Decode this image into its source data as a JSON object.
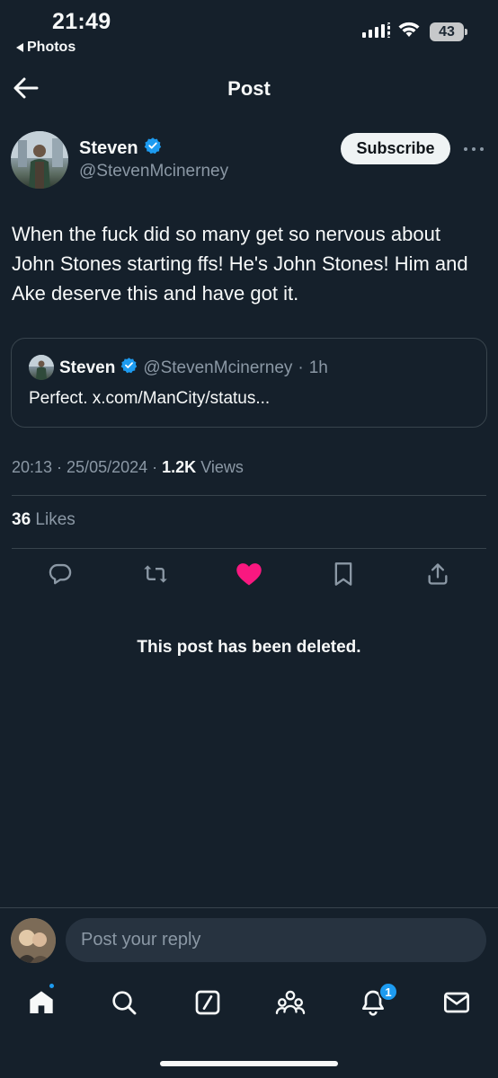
{
  "status_bar": {
    "time": "21:49",
    "back_app": "Photos",
    "battery": "43"
  },
  "header": {
    "title": "Post"
  },
  "post": {
    "author_name": "Steven",
    "author_handle": "@StevenMcinerney",
    "subscribe_label": "Subscribe",
    "text": "When the fuck did so many get so nervous about John Stones starting ffs! He's John Stones! Him and Ake deserve this and have got it.",
    "quote": {
      "author_name": "Steven",
      "author_handle": "@StevenMcinerney",
      "separator": "·",
      "age": "1h",
      "text": "Perfect. x.com/ManCity/status..."
    },
    "timestamp": "20:13 · 25/05/2024 ·",
    "views_count": "1.2K",
    "views_label": "Views",
    "likes_count": "36",
    "likes_label": "Likes",
    "liked": true
  },
  "deleted_notice": "This post has been deleted.",
  "reply": {
    "placeholder": "Post your reply"
  },
  "nav": {
    "notifications_badge": "1"
  },
  "colors": {
    "background": "#15202b",
    "accent": "#1d9bf0",
    "like": "#f91880",
    "muted": "#8b98a5",
    "border": "#38444d"
  }
}
